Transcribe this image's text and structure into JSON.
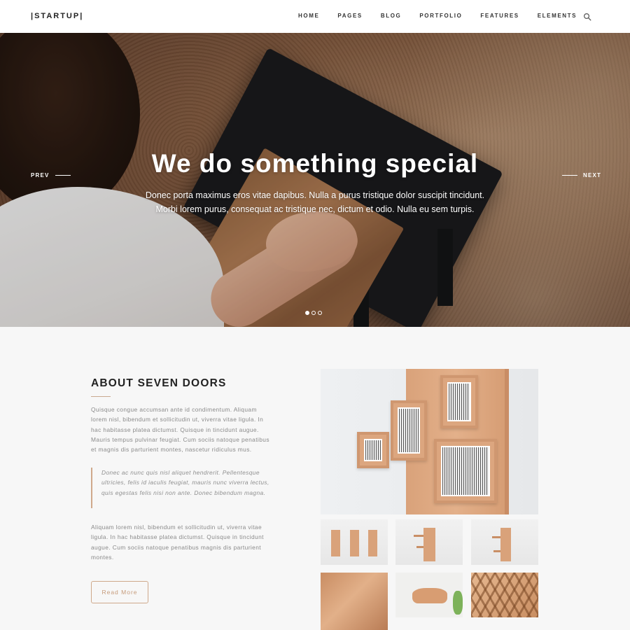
{
  "header": {
    "logo": "|STARTUP|",
    "nav": [
      "HOME",
      "PAGES",
      "BLOG",
      "PORTFOLIO",
      "FEATURES",
      "ELEMENTS"
    ],
    "search_icon": "search-icon"
  },
  "hero": {
    "title": "We do something special",
    "subtitle": "Donec porta maximus eros vitae dapibus. Nulla a purus tristique dolor suscipit tincidunt. Morbi lorem purus, consequat ac tristique nec, dictum et odio. Nulla eu sem turpis.",
    "prev_label": "PREV",
    "next_label": "NEXT",
    "slides": 3,
    "active_slide": 1
  },
  "about": {
    "title": "ABOUT SEVEN DOORS",
    "paragraph1": "Quisque congue accumsan ante id condimentum. Aliquam lorem nisl, bibendum et sollicitudin ut, viverra vitae ligula. In hac habitasse platea dictumst. Quisque in tincidunt augue. Mauris tempus pulvinar feugiat. Cum sociis natoque penatibus et magnis dis parturient montes, nascetur ridiculus mus.",
    "quote": "Donec ac nunc quis nisl aliquet hendrerit. Pellentesque ultricies, felis id iaculis feugiat, mauris nunc viverra lectus, quis egestas felis nisi non ante. Donec bibendum magna.",
    "paragraph2": "Aliquam lorem nisl, bibendum et sollicitudin ut, viverra vitae ligula. In hac habitasse platea dictumst. Quisque in tincidunt augue. Cum sociis natoque penatibus magnis dis parturient montes.",
    "button_label": "Read More"
  },
  "colors": {
    "accent": "#cfa98b",
    "header_bg": "#ffffff",
    "section_bg": "#f7f7f7"
  }
}
